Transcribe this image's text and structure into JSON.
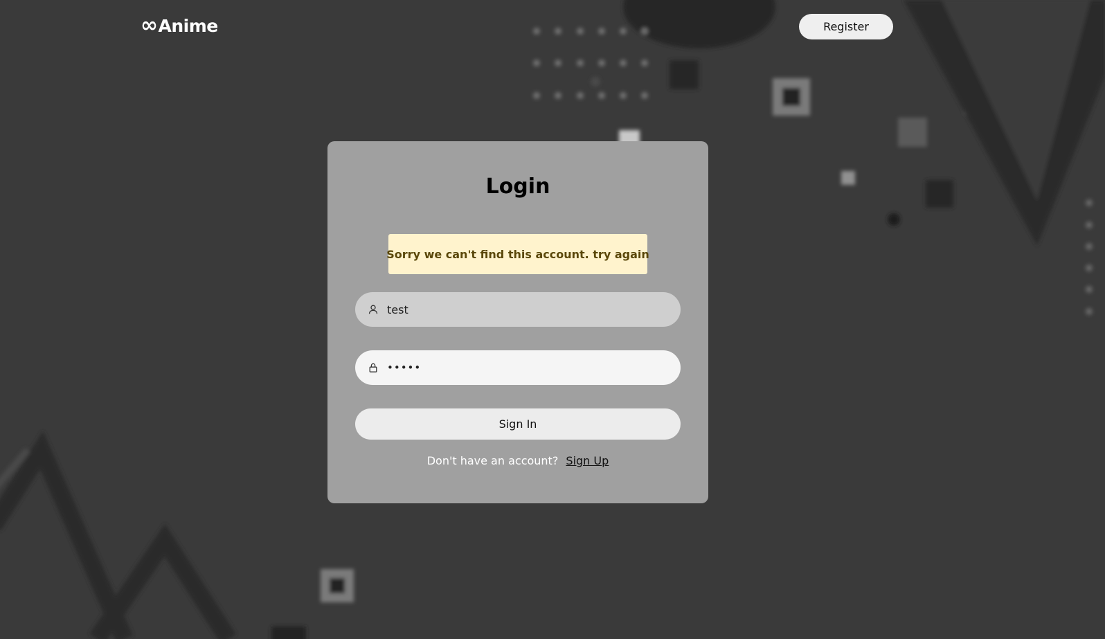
{
  "header": {
    "logo_symbol": "∞",
    "logo_text": "Anime",
    "register_label": "Register"
  },
  "login": {
    "title": "Login",
    "alert": "Sorry we can't find this account. try again",
    "username": {
      "value": "test",
      "icon": "user-icon"
    },
    "password": {
      "value": "•••••",
      "icon": "lock-icon"
    },
    "signin_label": "Sign In",
    "no_account_text": "Don't have an account?",
    "signup_label": "Sign Up"
  },
  "colors": {
    "background": "#3a3a3a",
    "card": "#a0a0a0",
    "alert_bg": "#fff3cd",
    "alert_text": "#5a4709"
  }
}
